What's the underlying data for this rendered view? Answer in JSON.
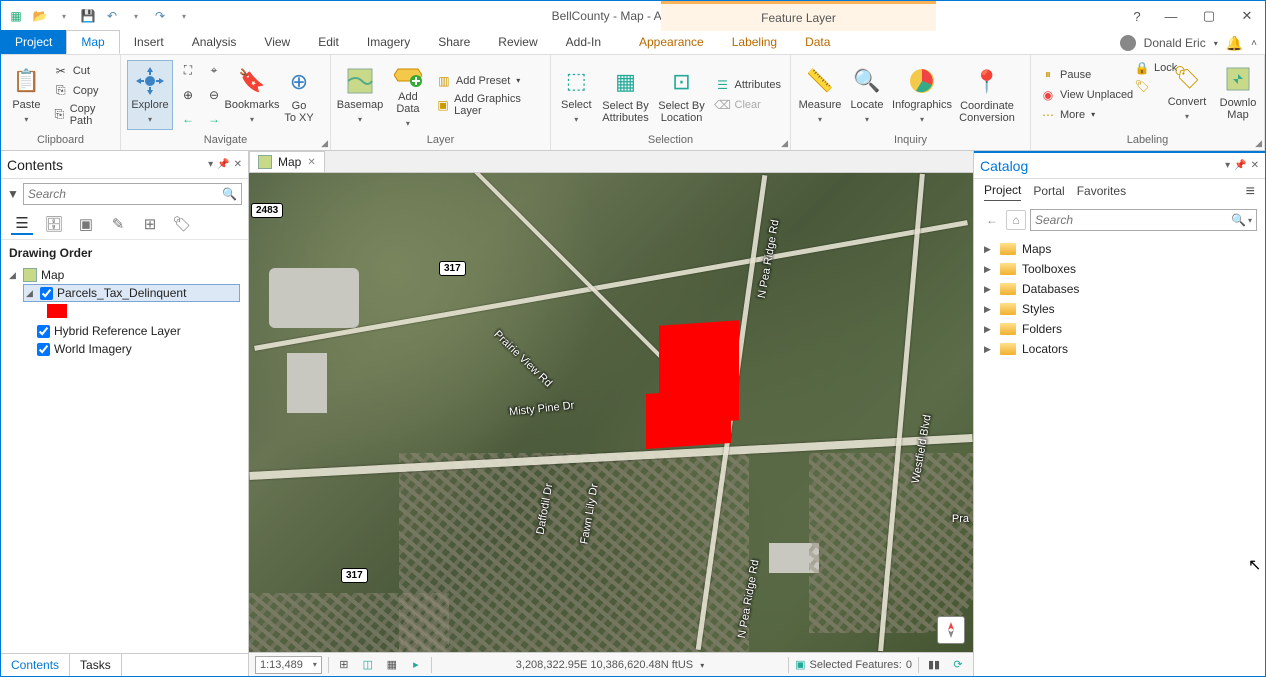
{
  "app": {
    "title": "BellCounty - Map - ArcGIS Pro",
    "contextual_header": "Feature Layer",
    "user": "Donald Eric"
  },
  "tabs": {
    "file": "Project",
    "items": [
      "Map",
      "Insert",
      "Analysis",
      "View",
      "Edit",
      "Imagery",
      "Share",
      "Review",
      "Add-In"
    ],
    "contextual": [
      "Appearance",
      "Labeling",
      "Data"
    ]
  },
  "ribbon": {
    "clipboard": {
      "label": "Clipboard",
      "paste": "Paste",
      "cut": "Cut",
      "copy": "Copy",
      "copypath": "Copy Path"
    },
    "navigate": {
      "label": "Navigate",
      "explore": "Explore",
      "bookmarks": "Bookmarks",
      "goto": "Go\nTo XY"
    },
    "layer": {
      "label": "Layer",
      "basemap": "Basemap",
      "adddata": "Add\nData",
      "addpreset": "Add Preset",
      "addgraphics": "Add Graphics Layer"
    },
    "selection": {
      "label": "Selection",
      "select": "Select",
      "selattr": "Select By\nAttributes",
      "selloc": "Select By\nLocation",
      "attributes": "Attributes",
      "clear": "Clear"
    },
    "inquiry": {
      "label": "Inquiry",
      "measure": "Measure",
      "locate": "Locate",
      "infog": "Infographics",
      "coord": "Coordinate\nConversion"
    },
    "labeling": {
      "label": "Labeling",
      "pause": "Pause",
      "lock": "Lock",
      "unplaced": "View Unplaced",
      "more": "More",
      "convert": "Convert",
      "download": "Downlo\nMap"
    }
  },
  "contents": {
    "title": "Contents",
    "search_placeholder": "Search",
    "heading": "Drawing Order",
    "root": "Map",
    "layers": {
      "parcels": "Parcels_Tax_Delinquent",
      "hybrid": "Hybrid Reference Layer",
      "imagery": "World Imagery"
    },
    "bottom_tabs": {
      "contents": "Contents",
      "tasks": "Tasks"
    }
  },
  "mapview": {
    "tab": "Map",
    "labels": {
      "pearidge": "N Pea Ridge Rd",
      "pearidge2": "N Pea Ridge Rd",
      "westfield": "Westfield Blvd",
      "prairie": "Prairie View Rd",
      "misty": "Misty Pine Dr",
      "daffodil": "Daffodil Dr",
      "fawnlily": "Fawn Lily Dr",
      "pra": "Pra"
    },
    "shields": {
      "a": "2483",
      "b": "317",
      "c": "317"
    }
  },
  "status": {
    "scale": "1:13,489",
    "coords": "3,208,322.95E 10,386,620.48N ftUS",
    "selected_label": "Selected Features:",
    "selected_count": "0"
  },
  "catalog": {
    "title": "Catalog",
    "tabs": {
      "project": "Project",
      "portal": "Portal",
      "favorites": "Favorites"
    },
    "search_placeholder": "Search",
    "items": [
      "Maps",
      "Toolboxes",
      "Databases",
      "Styles",
      "Folders",
      "Locators"
    ]
  }
}
